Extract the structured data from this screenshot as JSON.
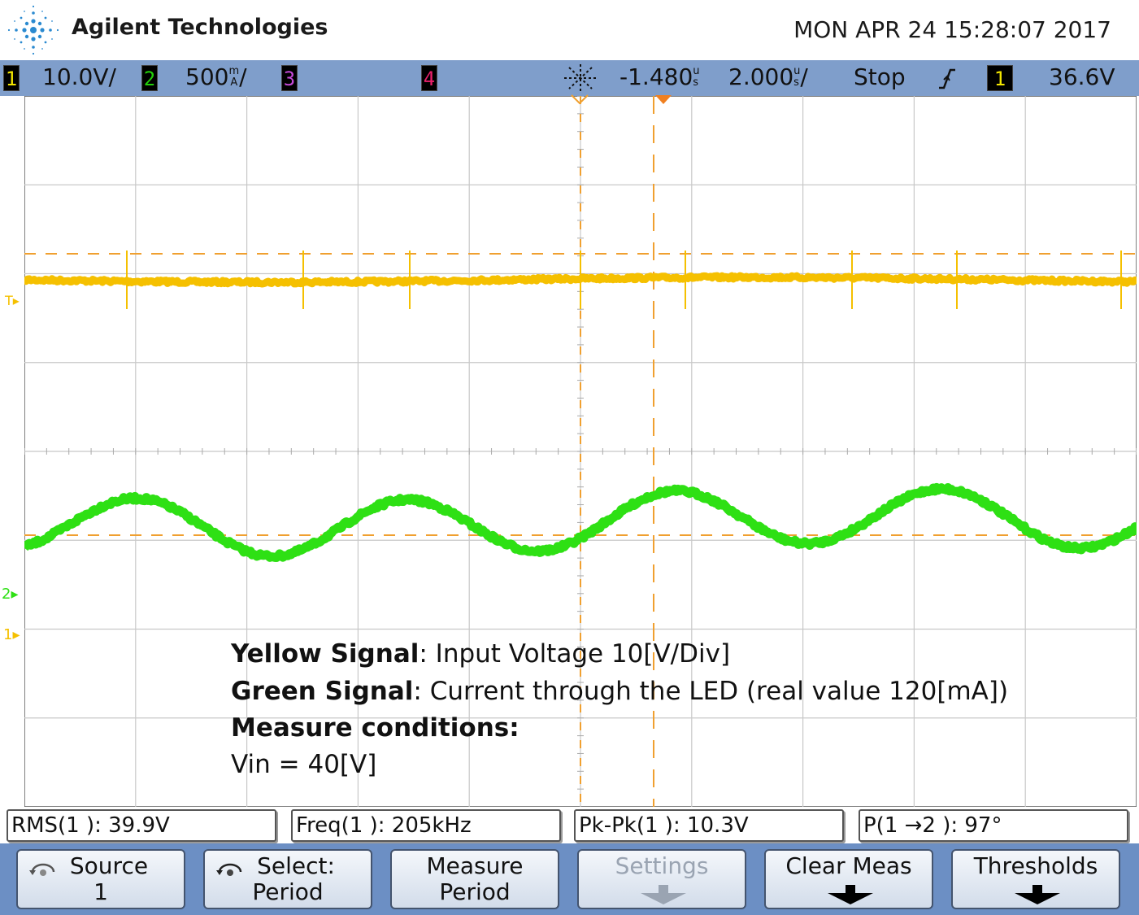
{
  "header": {
    "brand": "Agilent Technologies",
    "datetime": "MON APR 24 15:28:07 2017"
  },
  "status": {
    "ch1": {
      "num": "1",
      "scale": "10.0V/",
      "color": "#f3e600"
    },
    "ch2": {
      "num": "2",
      "scale": "500",
      "unit_top": "m",
      "unit_bottom": "A",
      "unit_slash": "/",
      "color": "#22d00a"
    },
    "ch3": {
      "num": "3",
      "color": "#c44ad8"
    },
    "ch4": {
      "num": "4",
      "color": "#e8206c"
    },
    "delay": "-1.480",
    "delay_unit_top": "u",
    "delay_unit_bottom": "s",
    "timebase": "2.000",
    "timebase_unit_top": "u",
    "timebase_unit_bottom": "s",
    "timebase_slash": "/",
    "run_state": "Stop",
    "trigger_edge_icon": "rising-edge-icon",
    "trigger_source": "1",
    "trigger_level": "36.6V"
  },
  "markers": {
    "trigger_level": "T",
    "ch2": "2",
    "ch1": "1"
  },
  "colors": {
    "ch1_trace": "#f5c000",
    "ch2_trace": "#2ee014",
    "cursor": "#f0a030",
    "grid": "#c8c8c8"
  },
  "annotation": {
    "line1_bold": "Yellow Signal",
    "line1_rest": ": Input Voltage  10[V/Div]",
    "line2_bold": "Green Signal",
    "line2_rest": ": Current through the LED (real value 120[mA])",
    "line3_bold": "Measure conditions:",
    "line4": "Vin = 40[V]"
  },
  "measurements": [
    {
      "label": "RMS(1 ): 39.9V"
    },
    {
      "label": "Freq(1 ): 205kHz"
    },
    {
      "label": "Pk-Pk(1 ): 10.3V"
    },
    {
      "label": "P(1 →2 ): 97°"
    }
  ],
  "softkeys": [
    {
      "line1": "Source",
      "line2": "1",
      "icon": "rotate-knob-icon"
    },
    {
      "line1": "Select:",
      "line2": "Period",
      "icon": "rotate-knob-icon"
    },
    {
      "line1": "Measure",
      "line2": "Period"
    },
    {
      "line1": "Settings",
      "icon": "down-arrow-icon",
      "disabled": true
    },
    {
      "line1": "Clear Meas",
      "icon": "down-arrow-icon"
    },
    {
      "line1": "Thresholds",
      "icon": "down-arrow-icon"
    }
  ]
}
